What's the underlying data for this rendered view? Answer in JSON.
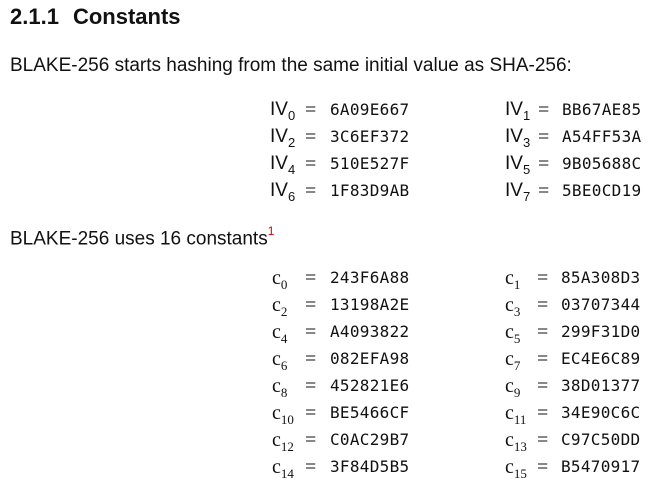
{
  "section": {
    "number": "2.1.1",
    "title": "Constants"
  },
  "iv_intro": "BLAKE-256 starts hashing from the same initial value as SHA-256:",
  "iv_symbol": "IV",
  "equals": "=",
  "iv": [
    {
      "index": "0",
      "value": "6A09E667"
    },
    {
      "index": "1",
      "value": "BB67AE85"
    },
    {
      "index": "2",
      "value": "3C6EF372"
    },
    {
      "index": "3",
      "value": "A54FF53A"
    },
    {
      "index": "4",
      "value": "510E527F"
    },
    {
      "index": "5",
      "value": "9B05688C"
    },
    {
      "index": "6",
      "value": "1F83D9AB"
    },
    {
      "index": "7",
      "value": "5BE0CD19"
    }
  ],
  "const_intro": "BLAKE-256 uses 16 constants",
  "footnote_mark": "1",
  "c_symbol": "c",
  "c": [
    {
      "index": "0",
      "value": "243F6A88"
    },
    {
      "index": "1",
      "value": "85A308D3"
    },
    {
      "index": "2",
      "value": "13198A2E"
    },
    {
      "index": "3",
      "value": "03707344"
    },
    {
      "index": "4",
      "value": "A4093822"
    },
    {
      "index": "5",
      "value": "299F31D0"
    },
    {
      "index": "6",
      "value": "082EFA98"
    },
    {
      "index": "7",
      "value": "EC4E6C89"
    },
    {
      "index": "8",
      "value": "452821E6"
    },
    {
      "index": "9",
      "value": "38D01377"
    },
    {
      "index": "10",
      "value": "BE5466CF"
    },
    {
      "index": "11",
      "value": "34E90C6C"
    },
    {
      "index": "12",
      "value": "C0AC29B7"
    },
    {
      "index": "13",
      "value": "C97C50DD"
    },
    {
      "index": "14",
      "value": "3F84D5B5"
    },
    {
      "index": "15",
      "value": "B5470917"
    }
  ]
}
